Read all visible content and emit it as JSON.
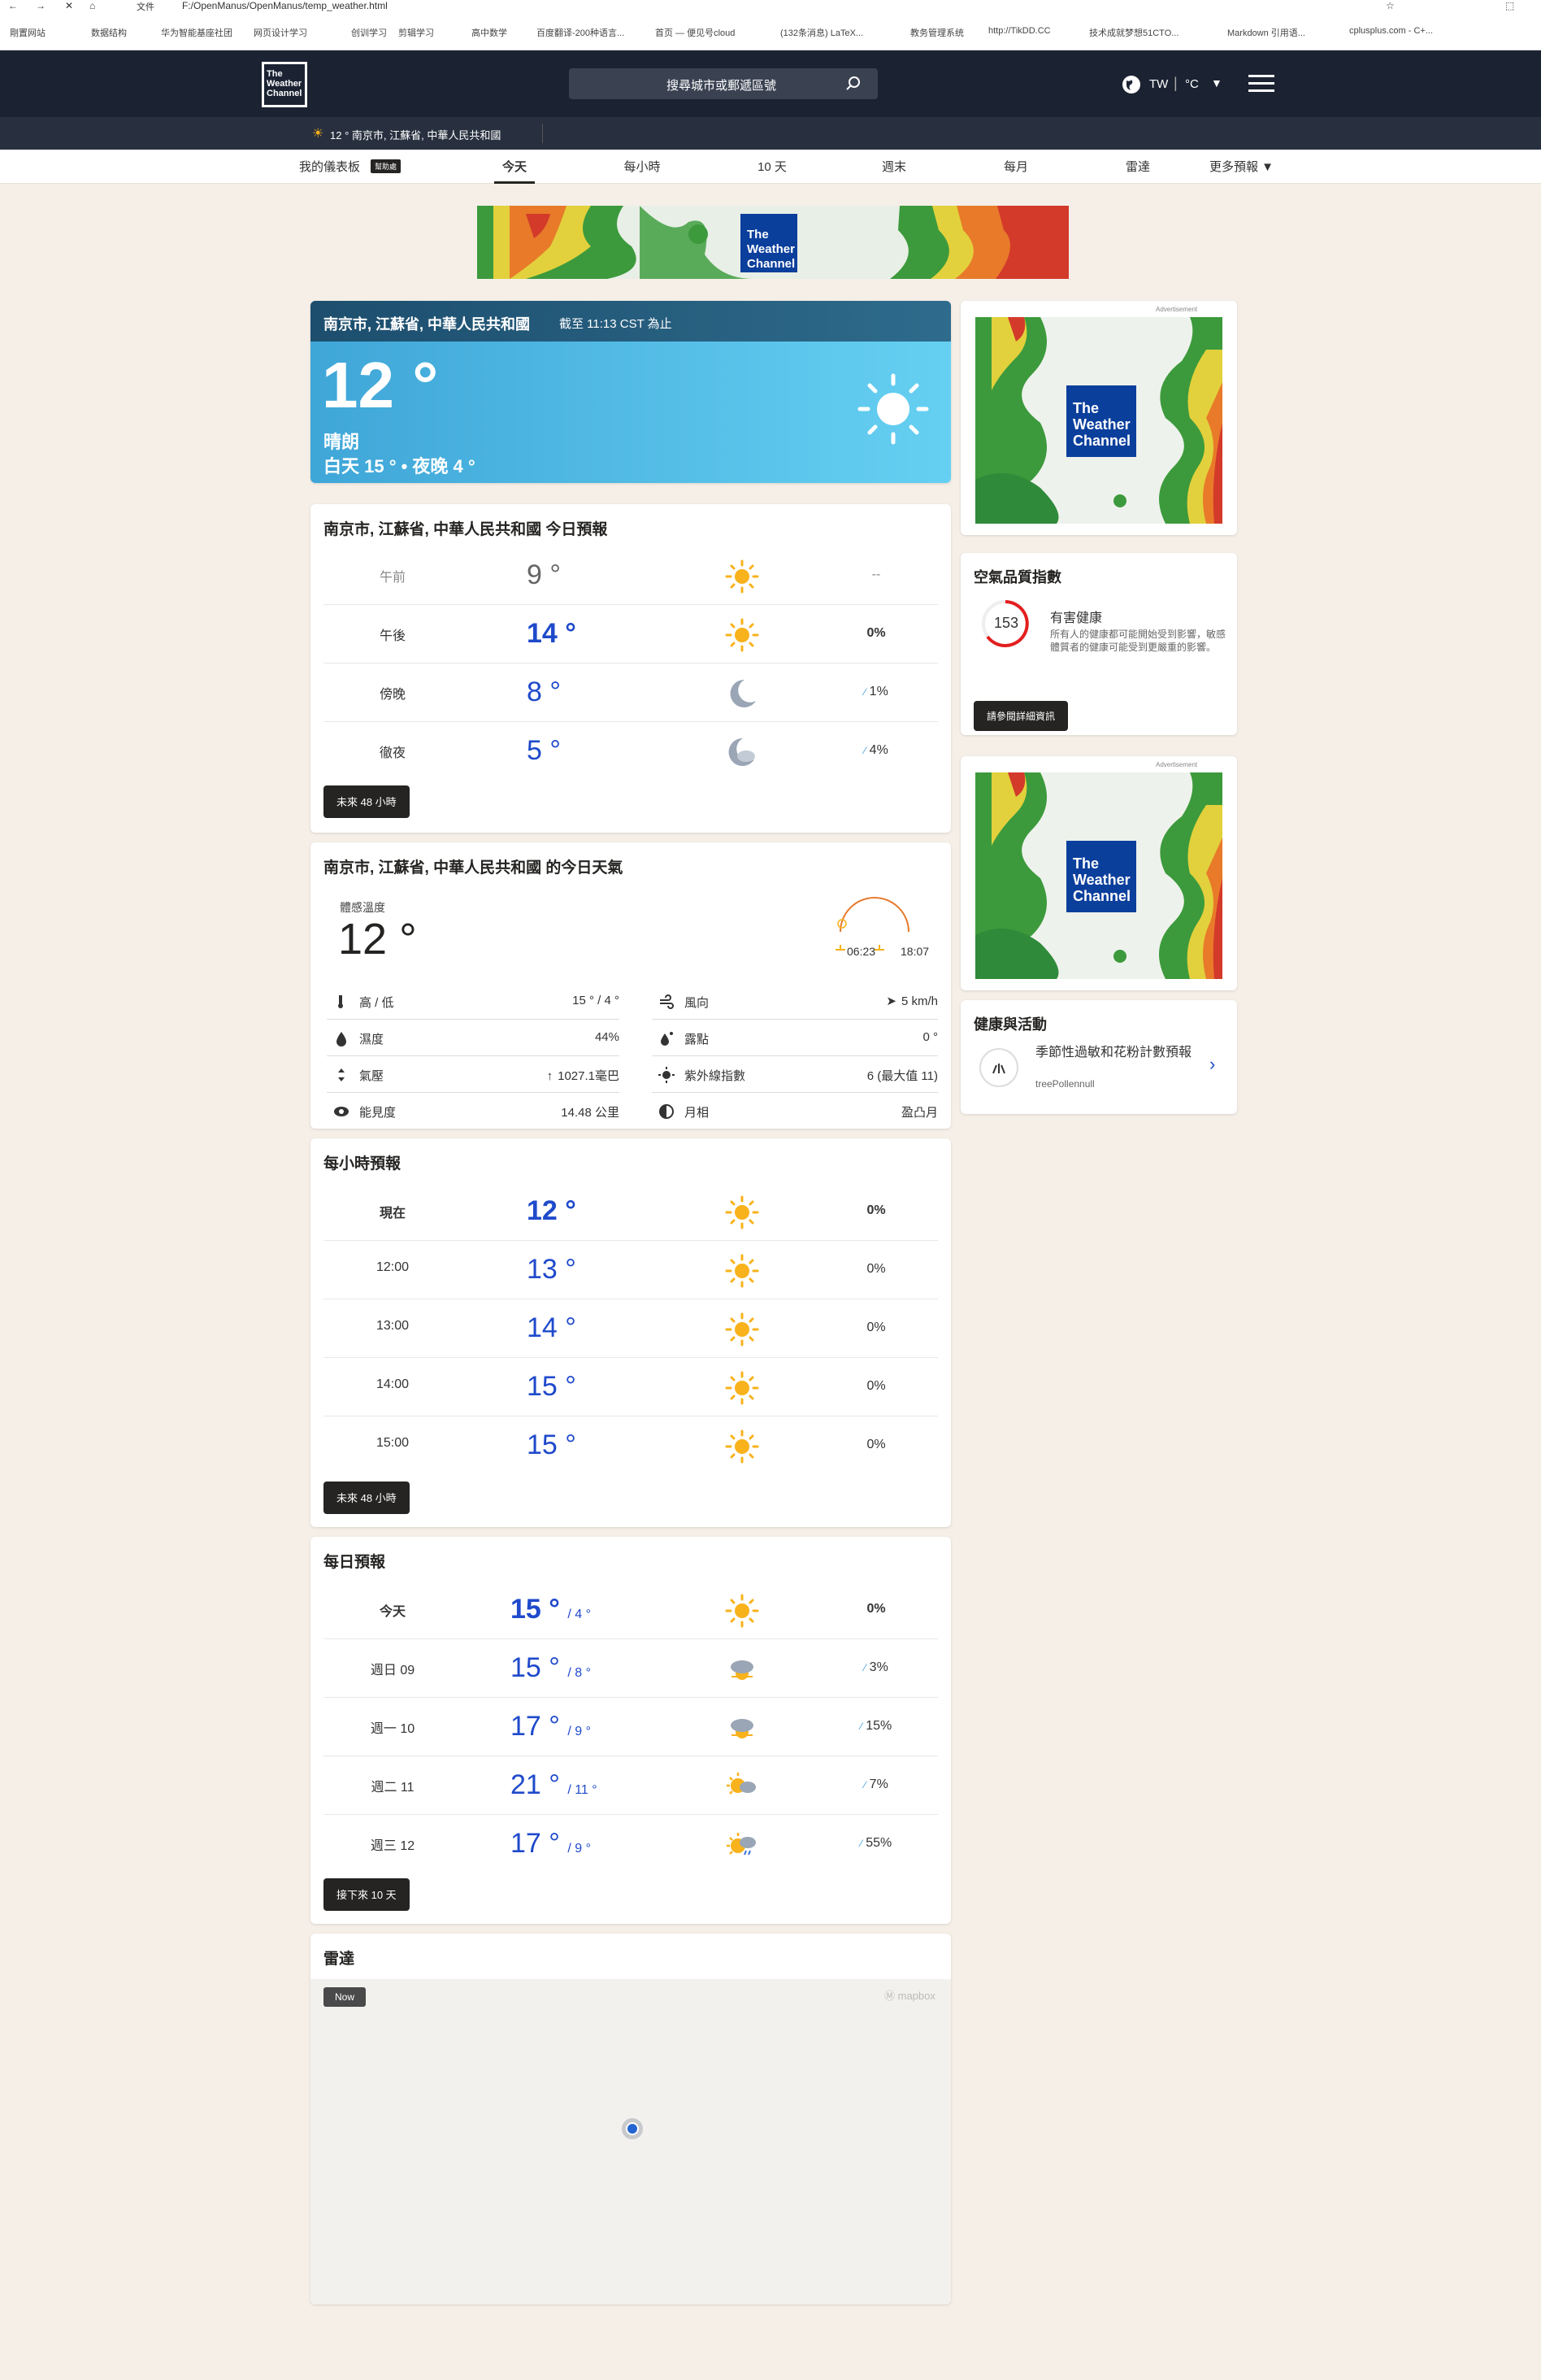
{
  "browser": {
    "address": "F:/OpenManus/OpenManus/temp_weather.html",
    "file_label": "文件",
    "bookmarks": [
      "剛置网站",
      "数据结构",
      "华为智能基座社团",
      "网页设计学习",
      "创训学习",
      "剪辑学习",
      "高中数学",
      "百度翻译-200种语言...",
      "首页 — 便见号cloud",
      "(132条消息) LaTeX...",
      "教务管理系统",
      "http://TikDD.CC",
      "技术成就梦想51CTO...",
      "Markdown 引用语...",
      "cplusplus.com - C+..."
    ]
  },
  "header": {
    "logo": [
      "The",
      "Weather",
      "Channel"
    ],
    "search_placeholder": "搜尋城市或郵遞區號",
    "locale": "TW",
    "unit": "°C"
  },
  "subbar": {
    "text": "12 ° 南京市, 江蘇省, 中華人民共和國"
  },
  "nav": {
    "dashboard": "我的儀表板",
    "badge": "幫助處",
    "items": [
      "今天",
      "每小時",
      "10 天",
      "週末",
      "每月",
      "雷達"
    ],
    "more": "更多預報"
  },
  "current": {
    "location": "南京市, 江蘇省, 中華人民共和國",
    "as_of": "截至 11:13 CST 為止",
    "temp": "12 °",
    "condition": "晴朗",
    "daynight": "白天 15 ° • 夜晚 4 °"
  },
  "today_forecast": {
    "title": "南京市, 江蘇省, 中華人民共和國 今日預報",
    "rows": [
      {
        "label": "午前",
        "temp": "9 °",
        "precip": "--",
        "icon": "sun-icon"
      },
      {
        "label": "午後",
        "temp": "14 °",
        "precip": "0%",
        "icon": "sun-icon"
      },
      {
        "label": "傍晚",
        "temp": "8 °",
        "precip": "1%",
        "icon": "moon-icon"
      },
      {
        "label": "徹夜",
        "temp": "5 °",
        "precip": "4%",
        "icon": "moon-cloud-icon"
      }
    ],
    "button": "未來 48 小時"
  },
  "today_details": {
    "title": "南京市, 江蘇省, 中華人民共和國 的今日天氣",
    "feels_label": "體感溫度",
    "feels": "12 °",
    "sunrise": "06:23",
    "sunset": "18:07",
    "left": [
      {
        "label": "高 / 低",
        "value": "15 ° / 4 °",
        "icon": "thermometer-icon"
      },
      {
        "label": "濕度",
        "value": "44%",
        "icon": "humidity-icon"
      },
      {
        "label": "氣壓",
        "value": "1027.1毫巴",
        "icon": "pressure-icon"
      },
      {
        "label": "能見度",
        "value": "14.48 公里",
        "icon": "eye-icon"
      }
    ],
    "right": [
      {
        "label": "風向",
        "value": "5 km/h",
        "icon": "wind-icon"
      },
      {
        "label": "露點",
        "value": "0 °",
        "icon": "dewpoint-icon"
      },
      {
        "label": "紫外線指數",
        "value": "6 (最大值 11)",
        "icon": "uv-icon"
      },
      {
        "label": "月相",
        "value": "盈凸月",
        "icon": "moon-phase-icon"
      }
    ]
  },
  "hourly": {
    "title": "每小時預報",
    "rows": [
      {
        "label": "現在",
        "temp": "12 °",
        "precip": "0%"
      },
      {
        "label": "12:00",
        "temp": "13 °",
        "precip": "0%"
      },
      {
        "label": "13:00",
        "temp": "14 °",
        "precip": "0%"
      },
      {
        "label": "14:00",
        "temp": "15 °",
        "precip": "0%"
      },
      {
        "label": "15:00",
        "temp": "15 °",
        "precip": "0%"
      }
    ],
    "button": "未來 48 小時"
  },
  "daily": {
    "title": "每日預報",
    "rows": [
      {
        "label": "今天",
        "hi": "15 °",
        "lo": "/ 4 °",
        "precip": "0%",
        "icon": "sun-icon"
      },
      {
        "label": "週日 09",
        "hi": "15 °",
        "lo": "/ 8 °",
        "precip": "3%",
        "icon": "cloud-sun-icon"
      },
      {
        "label": "週一 10",
        "hi": "17 °",
        "lo": "/ 9 °",
        "precip": "15%",
        "icon": "cloud-sun-icon"
      },
      {
        "label": "週二 11",
        "hi": "21 °",
        "lo": "/ 11 °",
        "precip": "7%",
        "icon": "sun-cloud-icon"
      },
      {
        "label": "週三 12",
        "hi": "17 °",
        "lo": "/ 9 °",
        "precip": "55%",
        "icon": "sun-rain-icon"
      }
    ],
    "button": "接下來 10 天"
  },
  "radar": {
    "title": "雷達",
    "now": "Now",
    "mapbox": "mapbox"
  },
  "sidebar": {
    "ad_label": "Advertisement",
    "aqi": {
      "title": "空氣品質指數",
      "value": "153",
      "level": "有害健康",
      "desc": "所有人的健康都可能開始受到影響，敏感體質者的健康可能受到更嚴重的影響。",
      "button": "請參閱詳細資訊"
    },
    "health": {
      "title": "健康與活動",
      "item": "季節性過敏和花粉計數預報",
      "sub": "treePollennull"
    }
  },
  "colors": {
    "accent": "#1f4acb",
    "header": "#1b2333",
    "sun": "#f8b21b",
    "aqi": "#e31f1f"
  }
}
